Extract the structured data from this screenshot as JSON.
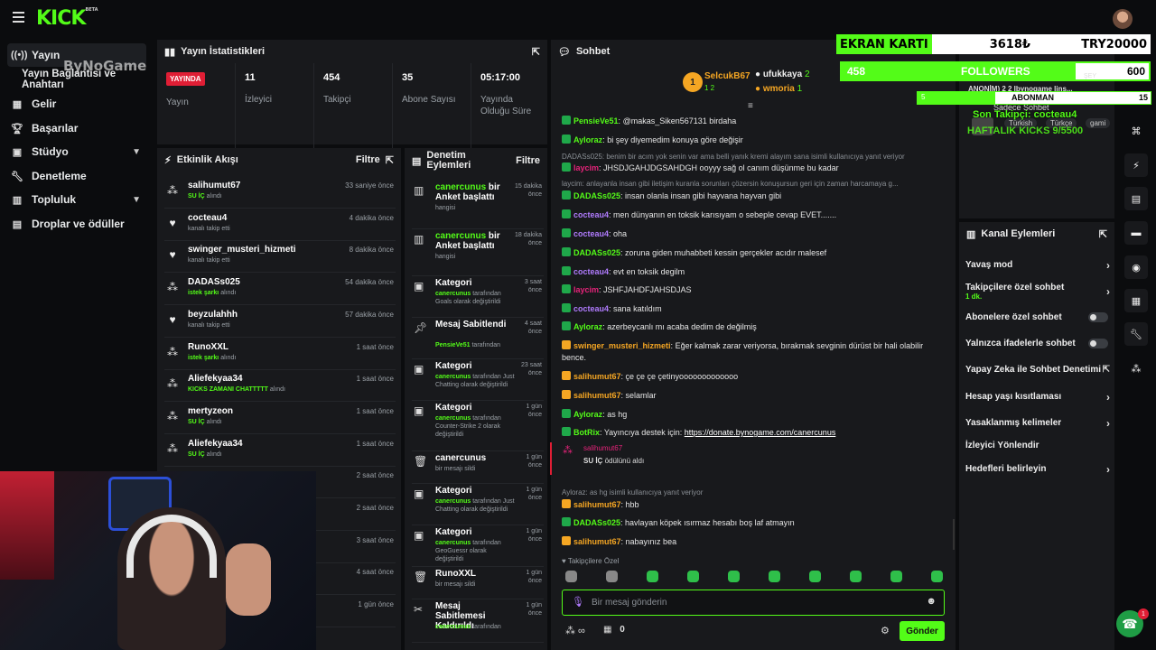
{
  "topbar": {
    "logo": "KICK",
    "logo_sup": "BETA"
  },
  "nav": [
    {
      "label": "Yayın",
      "icon": "broadcast-icon",
      "active": true
    },
    {
      "label": "Yayın Bağlantısı ve Anahtarı"
    },
    {
      "label": "Gelir",
      "icon": "wallet-icon"
    },
    {
      "label": "Başarılar",
      "icon": "trophy-icon"
    },
    {
      "label": "Stüdyo",
      "icon": "studio-icon",
      "chevron": true
    },
    {
      "label": "Denetleme",
      "icon": "wrench-icon"
    },
    {
      "label": "Topluluk",
      "icon": "community-icon",
      "chevron": true
    },
    {
      "label": "Droplar ve ödüller",
      "icon": "gift-icon"
    }
  ],
  "watermark": "ByNoGame",
  "stats": {
    "title": "Yayın İstatistikleri",
    "items": [
      {
        "value": "YAYINDA",
        "label": "Yayın"
      },
      {
        "value": "11",
        "label": "İzleyici"
      },
      {
        "value": "454",
        "label": "Takipçi"
      },
      {
        "value": "35",
        "label": "Abone Sayısı"
      },
      {
        "value": "05:17:00",
        "label": "Yayında Olduğu Süre"
      }
    ]
  },
  "activity": {
    "title": "Etkinlik Akışı",
    "filter": "Filtre",
    "events": [
      {
        "name": "salihumut67",
        "desc": "SU İÇ",
        "suffix": "alındı",
        "time": "33 saniye önce",
        "icon": "gift-icon"
      },
      {
        "name": "cocteau4",
        "desc": "kanalı takip etti",
        "time": "4 dakika önce",
        "icon": "heart-icon"
      },
      {
        "name": "swinger_musteri_hizmeti",
        "desc": "kanalı takip etti",
        "time": "8 dakika önce",
        "icon": "heart-icon"
      },
      {
        "name": "DADASs025",
        "desc": "istek şarkı",
        "suffix": "alındı",
        "time": "54 dakika önce",
        "icon": "gift-icon"
      },
      {
        "name": "beyzulahhh",
        "desc": "kanalı takip etti",
        "time": "57 dakika önce",
        "icon": "heart-icon"
      },
      {
        "name": "RunoXXL",
        "desc": "istek şarkı",
        "suffix": "alındı",
        "time": "1 saat önce",
        "icon": "gift-icon"
      },
      {
        "name": "Aliefekyaa34",
        "desc": "KICKS ZAMANI CHATTTTT",
        "suffix": "alındı",
        "time": "1 saat önce",
        "icon": "gift-icon"
      },
      {
        "name": "mertyzeon",
        "desc": "SU İÇ",
        "suffix": "alındı",
        "time": "1 saat önce",
        "icon": "gift-icon"
      },
      {
        "name": "Aliefekyaa34",
        "desc": "SU İÇ",
        "suffix": "alındı",
        "time": "1 saat önce",
        "icon": "gift-icon"
      },
      {
        "name": "",
        "desc": "",
        "time": "2 saat önce"
      },
      {
        "name": "",
        "desc": "",
        "time": "2 saat önce"
      },
      {
        "name": "",
        "desc": "",
        "time": "3 saat önce"
      },
      {
        "name": "",
        "desc": "",
        "time": "4 saat önce"
      },
      {
        "name": "",
        "desc": "",
        "time": "1 gün önce"
      }
    ]
  },
  "moderation": {
    "title": "Denetim Eylemleri",
    "filter": "Filtre",
    "items": [
      {
        "icon": "chart-icon",
        "user": "canercunus",
        "action": " bir Anket başlattı",
        "desc": "hangisi",
        "time": "15 dakika önce"
      },
      {
        "icon": "chart-icon",
        "user": "canercunus",
        "action": " bir Anket başlattı",
        "desc": "hangisi",
        "time": "18 dakika önce"
      },
      {
        "icon": "category-icon",
        "user": "",
        "action": "Kategori",
        "desc_user": "canercunus",
        "desc": " tarafından Goals olarak değiştirildi",
        "time": "3 saat önce"
      },
      {
        "icon": "pin-icon",
        "user": "",
        "action": "Mesaj Sabitlendi",
        "desc_user": "PensieVe51",
        "desc": " tarafından",
        "time": "4 saat önce"
      },
      {
        "icon": "category-icon",
        "user": "",
        "action": "Kategori",
        "desc_user": "canercunus",
        "desc": " tarafından Just Chatting olarak değiştirildi",
        "time": "23 saat önce"
      },
      {
        "icon": "category-icon",
        "user": "",
        "action": "Kategori",
        "desc_user": "canercunus",
        "desc": " tarafından Counter-Strike 2 olarak değiştirildi",
        "time": "1 gün önce"
      },
      {
        "icon": "trash-icon",
        "user": "",
        "action": "canercunus",
        "desc": "bir mesajı sildi",
        "time": "1 gün önce"
      },
      {
        "icon": "category-icon",
        "user": "",
        "action": "Kategori",
        "desc_user": "canercunus",
        "desc": " tarafından Just Chatting olarak değiştirildi",
        "time": "1 gün önce"
      },
      {
        "icon": "category-icon",
        "user": "",
        "action": "Kategori",
        "desc_user": "canercunus",
        "desc": " tarafından GeoGuessr olarak değiştirildi",
        "time": "1 gün önce"
      },
      {
        "icon": "trash-icon",
        "user": "",
        "action": "RunoXXL",
        "desc": "bir mesajı sildi",
        "time": "1 gün önce"
      },
      {
        "icon": "unpin-icon",
        "user": "",
        "action": "Mesaj Sabitlemesi Kaldırıldı",
        "desc_user": "canercunus",
        "desc": " tarafından",
        "time": "1 gün önce"
      }
    ]
  },
  "chat": {
    "title": "Sohbet",
    "top_gifters": [
      {
        "name": "SelcukB67",
        "count": "1 2"
      },
      {
        "name": "ufukkaya",
        "count": "2"
      },
      {
        "name": "wmoria",
        "count": "1"
      }
    ],
    "lines": [
      {
        "user": "PensieVe51",
        "color": "#53fc18",
        "text": "@makas_Siken567131 birdaha"
      },
      {
        "user": "Ayloraz",
        "color": "#53fc18",
        "text": "bi şey diyemedim konuya göre değişir"
      },
      {
        "reply": "DADASs025: benim bir acım yok senin var ama belli yanık kremi alayım sana isimli kullanıcıya yanıt veriyor"
      },
      {
        "user": "laycim",
        "color": "#e6237a",
        "text": "JHSDJGAHJDGSAHDGH ooyyy sağ ol canım düşünme bu kadar"
      },
      {
        "reply": "laycim: anlayanla insan gibi iletişim kuranla sorunları çözersin konuşursun geri için zaman harcamaya g..."
      },
      {
        "user": "DADASs025",
        "color": "#53fc18",
        "text": "insan olanla insan gibi hayvana hayvan gibi"
      },
      {
        "user": "cocteau4",
        "color": "#b17cff",
        "text": "men dünyanın en toksik karısıyam o sebeple cevap EVET......."
      },
      {
        "user": "cocteau4",
        "color": "#b17cff",
        "text": "oha"
      },
      {
        "user": "DADASs025",
        "color": "#53fc18",
        "text": "zoruna giden muhabbeti kessin gerçekler acıdır malesef"
      },
      {
        "user": "cocteau4",
        "color": "#b17cff",
        "text": "evt en toksik degilm"
      },
      {
        "user": "laycim",
        "color": "#e6237a",
        "text": "JSHFJAHDFJAHSDJAS"
      },
      {
        "user": "cocteau4",
        "color": "#b17cff",
        "text": "sana katıldım"
      },
      {
        "user": "Ayloraz",
        "color": "#53fc18",
        "text": "azerbeycanlı mı acaba dedim de değilmiş"
      },
      {
        "user": "swinger_musteri_hizmeti",
        "color": "#f5a623",
        "text": "Eğer kalmak zarar veriyorsa, bırakmak sevginin dürüst bir hali olabilir bence."
      },
      {
        "user": "salihumut67",
        "color": "#f5a623",
        "text": "çe çe çe çetinyooooooooooooo"
      },
      {
        "user": "salihumut67",
        "color": "#f5a623",
        "text": "selamlar"
      },
      {
        "user": "Ayloraz",
        "color": "#53fc18",
        "text": "as hg"
      },
      {
        "user": "BotRix",
        "color": "#53fc18",
        "text": "Yayıncıya destek için: ",
        "link": "https://donate.bynogame.com/canercunus"
      },
      {
        "reward_user": "salihumut67",
        "reward": "SU İÇ",
        "reward_suffix": "ödülünü aldı"
      },
      {
        "reply": "Ayloraz: as hg isimli kullanıcıya yanıt veriyor"
      },
      {
        "user": "salihumut67",
        "color": "#f5a623",
        "text": "hbb"
      },
      {
        "user": "DADASs025",
        "color": "#53fc18",
        "text": "havlayan köpek ısırmaz hesabı boş laf atmayın"
      },
      {
        "user": "salihumut67",
        "color": "#f5a623",
        "text": "nabayınız bea"
      }
    ],
    "followers_only": "Takipçilere Özel",
    "input_placeholder": "Bir mesaj gönderin",
    "kicks_count": "0",
    "send_label": "Gönder"
  },
  "channel": {
    "title": "Kanal Eylemleri",
    "items": [
      {
        "label": "Yavaş mod",
        "type": "chevron"
      },
      {
        "label": "Takipçilere özel sohbet",
        "sub": "1 dk.",
        "type": "chevron"
      },
      {
        "label": "Abonelere özel sohbet",
        "type": "toggle"
      },
      {
        "label": "Yalnızca ifadelerle sohbet",
        "type": "toggle"
      },
      {
        "label": "Yapay Zeka ile Sohbet Denetimi",
        "type": "external"
      },
      {
        "label": "Hesap yaşı kısıtlaması",
        "type": "chevron"
      },
      {
        "label": "Yasaklanmış kelimeler",
        "type": "chevron"
      },
      {
        "label": "İzleyici Yönlendir",
        "type": "none"
      },
      {
        "label": "Hedefleri belirleyin",
        "type": "chevron"
      }
    ],
    "top_partial": {
      "line1": "ANONİM) 2 2 Ibynogame lins...",
      "line2": "Sadece Sohbet",
      "langs": [
        "Türkish",
        "Türkçe",
        "gami"
      ]
    }
  },
  "overlay": {
    "gpu_label": "EKRAN KARTI",
    "gpu_amount": "3618₺",
    "gpu_goal": "TRY20000",
    "followers_current": "458",
    "followers_label": "FOLLOWERS",
    "followers_goal": "600",
    "followers_fraction": 0.763,
    "subs_current": "5",
    "subs_label": "ABONMAN",
    "subs_goal": "15",
    "subs_fraction": 0.333,
    "last_follower": "Son Takipçi: cocteau4",
    "weekly_kicks": "HAFTALIK KICKS 9/5500",
    "kisi": "ŞEY"
  },
  "colors": {
    "accent": "#53fc18",
    "panel": "#18191c",
    "bg": "#0b0c0e",
    "live": "#e01e35"
  }
}
